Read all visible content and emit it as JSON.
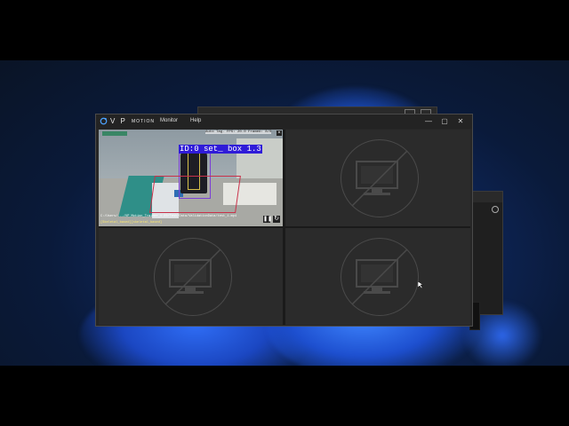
{
  "app": {
    "brand": "V P",
    "brand_sub": "MOTION",
    "menu": [
      "Monitor",
      "Help"
    ],
    "minimize": "—",
    "maximize": "▢",
    "close": "✕"
  },
  "video": {
    "header_text": "Auto Tag. FPS: 20.0 Frame#: 8/0",
    "detection_label": "ID:0 set_ box 1.3",
    "file_path": "C:/Users/.../VP Motion_Trainer_1.23/Test/Data/ValidationData/test_1.mp4",
    "tags": "[Skeletal_based][skeletal_based]"
  },
  "colors": {
    "window_bg": "#262626",
    "cell_bg": "#2b2b2b",
    "accent": "#4da3ff",
    "detection": "#2f1bd8"
  }
}
